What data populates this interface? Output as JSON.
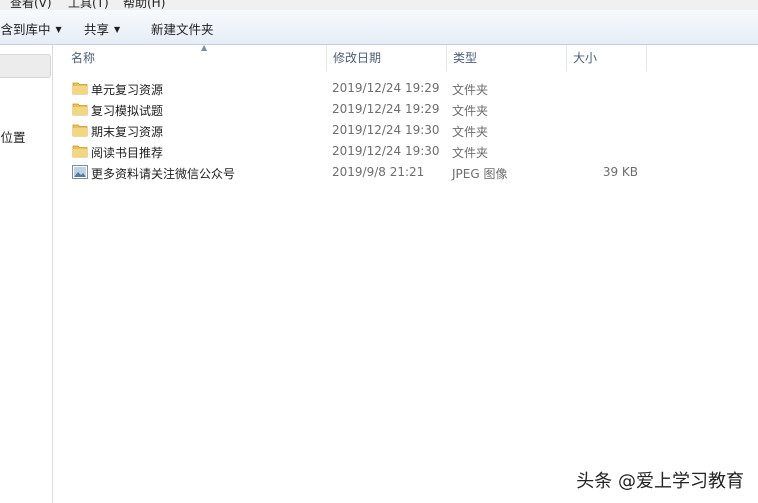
{
  "menu": {
    "view": "查看(V)",
    "tools": "工具(T)",
    "help": "帮助(H)"
  },
  "toolbar": {
    "add_to_library": "包含到库中",
    "share": "共享",
    "new_folder": "新建文件夹"
  },
  "nav": {
    "item_partial": "的位置"
  },
  "columns": {
    "name": "名称",
    "date": "修改日期",
    "type": "类型",
    "size": "大小"
  },
  "files": [
    {
      "name": "单元复习资源",
      "date": "2019/12/24 19:29",
      "type": "文件夹",
      "size": "",
      "icon": "folder-icon"
    },
    {
      "name": "复习模拟试题",
      "date": "2019/12/24 19:29",
      "type": "文件夹",
      "size": "",
      "icon": "folder-icon"
    },
    {
      "name": "期末复习资源",
      "date": "2019/12/24 19:30",
      "type": "文件夹",
      "size": "",
      "icon": "folder-icon"
    },
    {
      "name": "阅读书目推荐",
      "date": "2019/12/24 19:30",
      "type": "文件夹",
      "size": "",
      "icon": "folder-icon"
    },
    {
      "name": "更多资料请关注微信公众号",
      "date": "2019/9/8 21:21",
      "type": "JPEG 图像",
      "size": "39 KB",
      "icon": "image-file-icon"
    }
  ],
  "watermark": "头条 @爱上学习教育",
  "colors": {
    "folder": "#e8c15a",
    "toolbar_top": "#f7fafd",
    "toolbar_bottom": "#e6edf6",
    "header_text": "#4c607a"
  }
}
